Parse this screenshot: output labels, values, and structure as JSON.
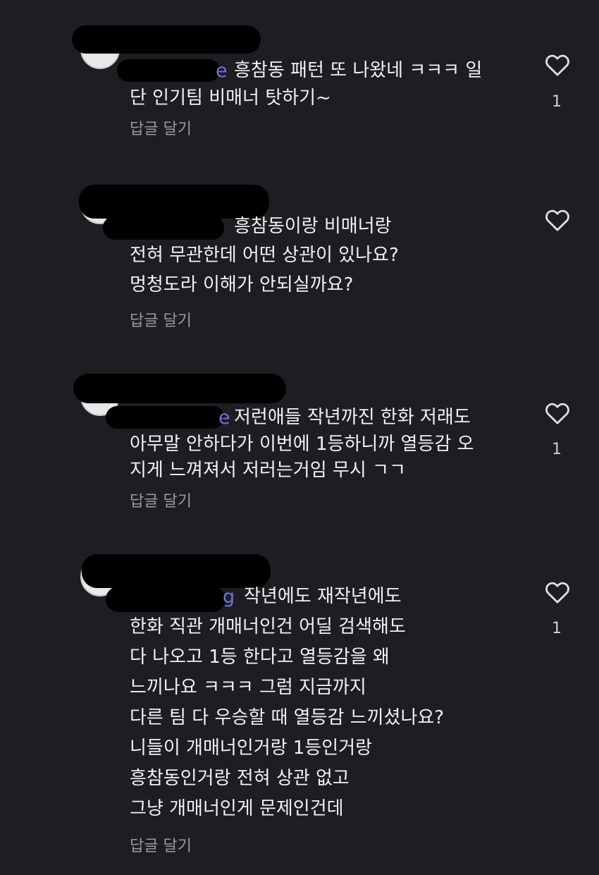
{
  "comments": [
    {
      "mention_tail": "e",
      "lines": [
        "흥참동 패턴 또 나왔네 ㅋㅋㅋ 일",
        "단 인기팀 비매너 탓하기~"
      ],
      "reply_label": "답글 달기",
      "likes": "1",
      "liked": false
    },
    {
      "mention_tail": "",
      "lines": [
        "흥참동이랑 비매너랑",
        "전혀 무관한데 어떤 상관이 있나요?",
        "멍청도라 이해가 안되실까요?"
      ],
      "reply_label": "답글 달기",
      "likes": "",
      "liked": false
    },
    {
      "mention_tail": "e",
      "lines": [
        "저런애들 작년까진 한화 저래도",
        "아무말 안하다가 이번에 1등하니까 열등감 오",
        "지게 느껴져서 저러는거임 무시 ㄱㄱ"
      ],
      "reply_label": "답글 달기",
      "likes": "1",
      "liked": false
    },
    {
      "mention_tail": "g",
      "lines": [
        "작년에도 재작년에도",
        "한화 직관 개매너인건 어딜 검색해도",
        "다 나오고 1등 한다고 열등감을 왜",
        "느끼나요 ㅋㅋㅋ 그럼 지금까지",
        "다른 팀 다 우승할 때 열등감 느끼셨나요?",
        "니들이 개매너인거랑 1등인거랑",
        "흥참동인거랑 전혀 상관 없고",
        "그냥 개매너인게 문제인건데"
      ],
      "reply_label": "답글 달기",
      "likes": "1",
      "liked": false
    }
  ],
  "icons": {
    "like": "heart-outline-icon"
  },
  "colors": {
    "background": "#1d1d22",
    "text": "#f2f2f2",
    "muted": "#9a9aa0",
    "mention": "#6b72d9"
  }
}
